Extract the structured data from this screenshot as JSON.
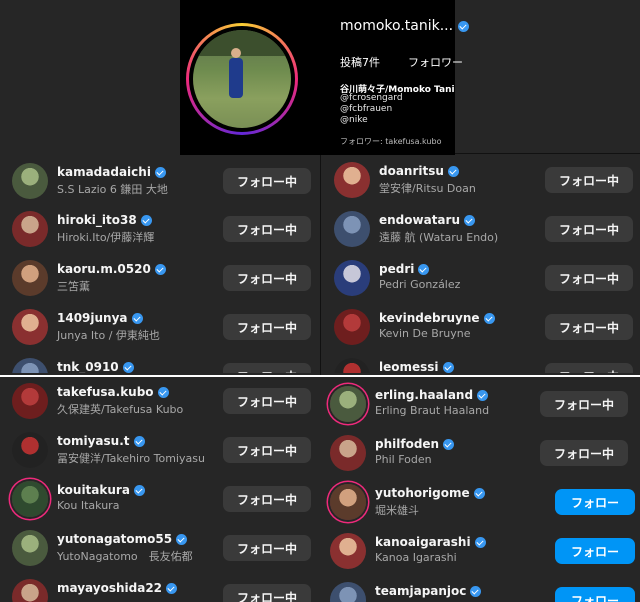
{
  "profile": {
    "username": "momoko.tanik...",
    "posts": "投稿7件",
    "followers": "フォロワー",
    "bio_name": "谷川萌々子/Momoko Tani",
    "bio_lines": [
      "@fcrosengard",
      "@fcbfrauen",
      "@nike"
    ],
    "followed_by": "フォロワー: takefusa.kubo"
  },
  "follow_label": "フォロー中",
  "follow_blue_label": "フォロー",
  "colors": {
    "bg": "#262626",
    "button": "#3a3a3a",
    "blue": "#0095f6",
    "verified": "#3897f0"
  },
  "top_left": [
    {
      "username": "kamadadaichi",
      "name": "S.S Lazio 6 鎌田 大地",
      "icon": "avatar-photo"
    },
    {
      "username": "hiroki_ito38",
      "name": "Hiroki.Ito/伊藤洋輝",
      "icon": "avatar-photo"
    },
    {
      "username": "kaoru.m.0520",
      "name": "三笘薫",
      "icon": "avatar-photo"
    },
    {
      "username": "1409junya",
      "name": "Junya Ito / 伊東純也",
      "icon": "avatar-photo"
    },
    {
      "username": "tnk_0910",
      "name": "",
      "icon": "avatar-photo"
    }
  ],
  "top_right": [
    {
      "username": "doanritsu",
      "name": "堂安律/Ritsu Doan",
      "icon": "avatar-photo"
    },
    {
      "username": "endowataru",
      "name": "遠藤 航 (Wataru Endo)",
      "icon": "avatar-photo"
    },
    {
      "username": "pedri",
      "name": "Pedri González",
      "icon": "avatar-photo"
    },
    {
      "username": "kevindebruyne",
      "name": "Kevin De Bruyne",
      "icon": "avatar-photo"
    },
    {
      "username": "leomessi",
      "name": "",
      "icon": "avatar-photo"
    }
  ],
  "bottom_left": [
    {
      "username": "takefusa.kubo",
      "name": "久保建英/Takefusa Kubo",
      "icon": "avatar-photo"
    },
    {
      "username": "tomiyasu.t",
      "name": "冨安健洋/Takehiro Tomiyasu",
      "icon": "avatar-photo"
    },
    {
      "username": "kouitakura",
      "name": "Kou Itakura",
      "icon": "avatar-photo"
    },
    {
      "username": "yutonagatomo55",
      "name": "YutoNagatomo　長友佑都",
      "icon": "avatar-photo"
    },
    {
      "username": "mayayoshida22",
      "name": "",
      "icon": "avatar-photo"
    }
  ],
  "bottom_right": [
    {
      "username": "erling.haaland",
      "name": "Erling Braut Haaland",
      "icon": "avatar-photo"
    },
    {
      "username": "philfoden",
      "name": "Phil Foden",
      "icon": "avatar-photo"
    },
    {
      "username": "yutohorigome",
      "name": "堀米雄斗",
      "icon": "avatar-photo"
    },
    {
      "username": "kanoaigarashi",
      "name": "Kanoa Igarashi",
      "icon": "avatar-photo"
    },
    {
      "username": "teamjapanjoc",
      "name": "",
      "icon": "avatar-photo"
    }
  ]
}
